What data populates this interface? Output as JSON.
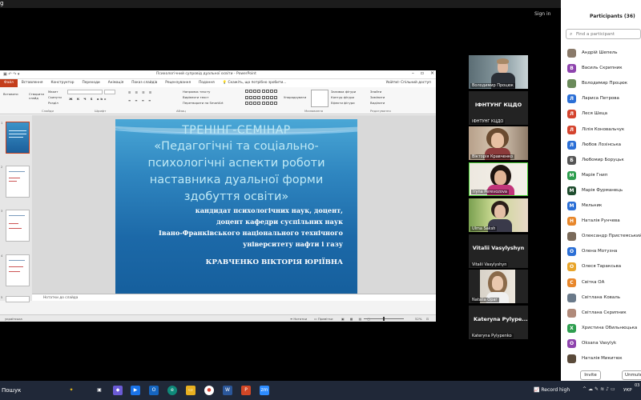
{
  "zoom": {
    "top_left": "g",
    "sign_in": "Sign in"
  },
  "ppt": {
    "window_title": "Психологічний супровід дуальної освіти - PowerPoint",
    "tabs": [
      "Файл",
      "Вставлення",
      "Конструктор",
      "Переходи",
      "Анімація",
      "Показ слайдів",
      "Рецензування",
      "Подання"
    ],
    "tell_me": "Скажіть, що потрібно зробити...",
    "user": "Увійти",
    "share": "Спільний доступ",
    "ribbon": {
      "new_slide": "Створити слайд",
      "layout": "Макет",
      "reset": "Скинути",
      "section": "Розділ",
      "group_slides": "Слайди",
      "group_font": "Шрифт",
      "group_paragraph": "Абзац",
      "group_drawing": "Малювання",
      "group_editing": "Редагування",
      "text_direction": "Напрямок тексту",
      "align_text": "Вирівняти текст",
      "convert_smartart": "Перетворити на SmartArt",
      "arrange": "Упорядкувати",
      "styles": "Експрес-стилі",
      "fill": "Заливка фігури",
      "outline": "Контур фігури",
      "effects": "Ефекти фігури",
      "find": "Знайти",
      "replace": "Замінити",
      "select": "Виділити",
      "paste": "Вставити"
    },
    "slide": {
      "heading": "ТРЕНІНГ-СЕМІНАР",
      "title_lines": [
        "«Педагогічні та соціально-",
        "психологічні аспекти роботи",
        "наставника  дуальної форми",
        "здобуття освіти»"
      ],
      "subtitle_lines": [
        "кандидат психологічних наук, доцент,",
        "доцент кафедри суспільних наук",
        "Івано-Франківського національного технічного",
        "університету нафти і газу"
      ],
      "presenter": "КРАВЧЕНКО ВІКТОРІЯ ЮРІЇВНА"
    },
    "notes_placeholder": "Нотатки до слайда",
    "status": {
      "language": "українська",
      "notes": "Нотатки",
      "comments": "Примітки",
      "zoom": "52%"
    }
  },
  "video_tiles": [
    {
      "name": "Володимир Процюк",
      "kind": "video"
    },
    {
      "name": "ІФНТУНГ КЦДО",
      "big": "ІФНТУНГ КЦДО",
      "kind": "text"
    },
    {
      "name": "Вікторія Кравченко",
      "kind": "video"
    },
    {
      "name": "Iryna Perevozova",
      "kind": "video"
    },
    {
      "name": "Ulma Saksh",
      "kind": "video"
    },
    {
      "name": "Vitalii Vasylyshyn",
      "big": "Vitalii Vasylyshyn",
      "kind": "text"
    },
    {
      "name": "Natalia Opar",
      "kind": "video"
    },
    {
      "name": "Kateryna Pylypenko",
      "big": "Kateryna  Pylype...",
      "kind": "text"
    }
  ],
  "participants": {
    "title": "Participants (36)",
    "search_placeholder": "Find a participant",
    "list": [
      {
        "name": "Андрій Шепель",
        "initial": "",
        "color": "#8a7a6a"
      },
      {
        "name": "Василь Скрипник",
        "initial": "В",
        "color": "#8e44ad"
      },
      {
        "name": "Володимир Процюк",
        "initial": "",
        "color": "#6a8a5a"
      },
      {
        "name": "Лариса Петрова",
        "initial": "Л",
        "color": "#2b6fd6"
      },
      {
        "name": "Леся Шеца",
        "initial": "Л",
        "color": "#d4442e"
      },
      {
        "name": "Лілія Коновальчук",
        "initial": "Л",
        "color": "#d4442e"
      },
      {
        "name": "Любов Лозінська",
        "initial": "Л",
        "color": "#2b6fd6"
      },
      {
        "name": "Любомир Боруцьк",
        "initial": "Б",
        "color": "#555555"
      },
      {
        "name": "Марія Гнип",
        "initial": "М",
        "color": "#2e9e4f"
      },
      {
        "name": "Марія Фурманець",
        "initial": "М",
        "color": "#1f4d2e"
      },
      {
        "name": "Мельник",
        "initial": "М",
        "color": "#2b6fd6"
      },
      {
        "name": "Наталія Рунчева",
        "initial": "Н",
        "color": "#e8872b"
      },
      {
        "name": "Олександр Пристемський",
        "initial": "",
        "color": "#7a6a5a"
      },
      {
        "name": "Олена Мотузна",
        "initial": "О",
        "color": "#2b6fd6"
      },
      {
        "name": "Олеся Тараксьва",
        "initial": "О",
        "color": "#e8a52b"
      },
      {
        "name": "Світка ОА",
        "initial": "С",
        "color": "#e8872b"
      },
      {
        "name": "Світлана Коваль",
        "initial": "",
        "color": "#6a7a8a"
      },
      {
        "name": "Світлана Скрипник",
        "initial": "",
        "color": "#b08a7a"
      },
      {
        "name": "Христина Обильнюцька",
        "initial": "Х",
        "color": "#2e9e4f"
      },
      {
        "name": "Oksana Vasylyk",
        "initial": "O",
        "color": "#8e44ad"
      },
      {
        "name": "Наталія Микитюк",
        "initial": "",
        "color": "#5a4a3a"
      }
    ],
    "invite": "Invite",
    "unmute": "Unmute"
  },
  "taskbar": {
    "search": "Пошук",
    "record": "Record high",
    "lang": "УКР",
    "clock": "03"
  }
}
